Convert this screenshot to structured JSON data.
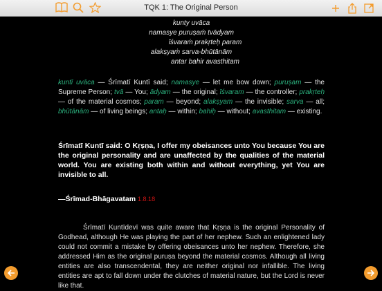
{
  "toolbar": {
    "title": "TQK 1: The Original Person",
    "accent": "#f39c2e"
  },
  "verse_lines": [
    "kunty uvāca",
    "namasye puruṣaṁ tvādyam",
    "īśvaraṁ prakṛteḥ param",
    "alakṣyaṁ sarva-bhūtānām",
    "antar bahir avasthitam"
  ],
  "synonyms": [
    {
      "w": "kuntī uvāca",
      "m": " — Śrīmatī Kuntī said; "
    },
    {
      "w": "namasye",
      "m": " — let me bow down; "
    },
    {
      "w": "puruṣam",
      "m": " — the Supreme Person; "
    },
    {
      "w": "tvā",
      "m": " — You; "
    },
    {
      "w": "ādyam",
      "m": " — the original; "
    },
    {
      "w": "īśvaram",
      "m": " — the controller; "
    },
    {
      "w": "prakṛteḥ",
      "m": " — of the material cosmos; "
    },
    {
      "w": "param",
      "m": " — beyond; "
    },
    {
      "w": "alakṣyam",
      "m": " — the invisible; "
    },
    {
      "w": "sarva",
      "m": " — all; "
    },
    {
      "w": "bhūtānām",
      "m": " — of living beings; "
    },
    {
      "w": "antaḥ",
      "m": " — within; "
    },
    {
      "w": "bahiḥ",
      "m": " — without; "
    },
    {
      "w": "avasthitam",
      "m": " — existing."
    }
  ],
  "translation": "Śrīmatī Kuntī said: O Kṛṣṇa, I offer my obeisances unto You because You are the original personality and are unaffected by the qualities of the material world. You are existing both within and without everything, yet You are invisible to all.",
  "source": {
    "name": "—Śrīmad-Bhāgavatam",
    "ref": "1.8.18"
  },
  "purport": "Śrīmatī Kuntīdevī was quite aware that Kṛṣṇa is the original Personality of Godhead, although He was playing the part of her nephew. Such an enlightened lady could not commit a mistake by offering obeisances unto her nephew. Therefore, she addressed Him as the original puruṣa beyond the material cosmos. Although all living entities are also transcendental, they are neither original nor infallible. The living entities are apt to fall down under the clutches of material nature, but the Lord is never like that."
}
